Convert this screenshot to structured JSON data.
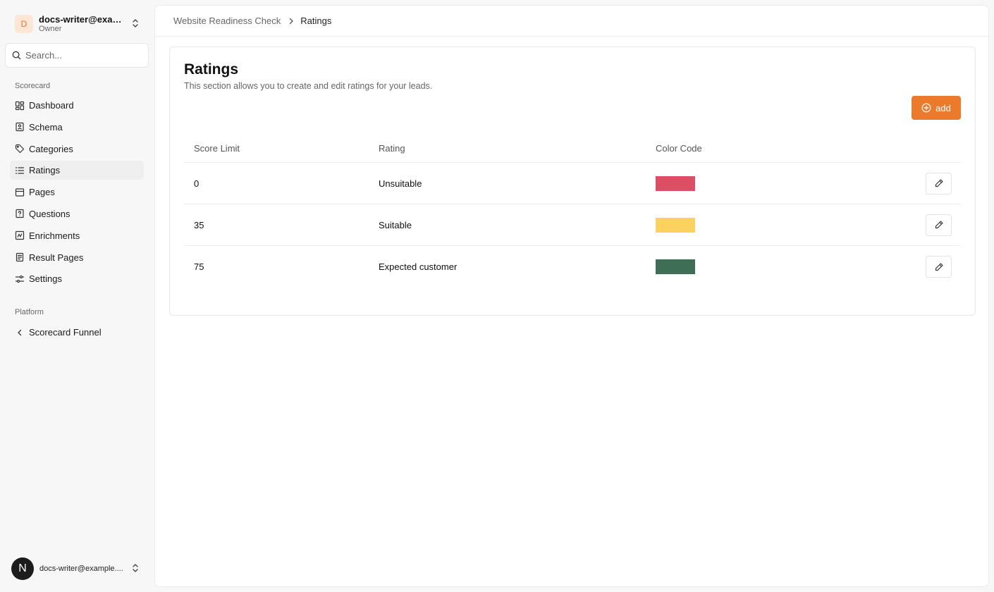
{
  "account": {
    "initial": "D",
    "name": "docs-writer@exam...",
    "role": "Owner"
  },
  "search": {
    "placeholder": "Search..."
  },
  "sidebar": {
    "group_label": "Scorecard",
    "items": [
      {
        "label": "Dashboard",
        "icon": "dashboard-icon",
        "active": false
      },
      {
        "label": "Schema",
        "icon": "schema-icon",
        "active": false
      },
      {
        "label": "Categories",
        "icon": "tag-icon",
        "active": false
      },
      {
        "label": "Ratings",
        "icon": "list-icon",
        "active": true
      },
      {
        "label": "Pages",
        "icon": "pages-icon",
        "active": false
      },
      {
        "label": "Questions",
        "icon": "question-icon",
        "active": false
      },
      {
        "label": "Enrichments",
        "icon": "enrichment-icon",
        "active": false
      },
      {
        "label": "Result Pages",
        "icon": "result-pages-icon",
        "active": false
      },
      {
        "label": "Settings",
        "icon": "settings-icon",
        "active": false
      }
    ],
    "platform_label": "Platform",
    "platform_item": {
      "label": "Scorecard Funnel",
      "icon": "chevron-left-icon"
    }
  },
  "user": {
    "initial": "N",
    "email": "docs-writer@example...."
  },
  "breadcrumb": {
    "parent": "Website Readiness Check",
    "current": "Ratings"
  },
  "ratings": {
    "title": "Ratings",
    "subtitle": "This section allows you to create and edit ratings for your leads.",
    "add_label": "add",
    "columns": [
      "Score Limit",
      "Rating",
      "Color Code"
    ],
    "rows": [
      {
        "score": "0",
        "rating": "Unsuitable",
        "color": "#dc4e63"
      },
      {
        "score": "35",
        "rating": "Suitable",
        "color": "#fbd25d"
      },
      {
        "score": "75",
        "rating": "Expected customer",
        "color": "#3f6e57"
      }
    ]
  }
}
